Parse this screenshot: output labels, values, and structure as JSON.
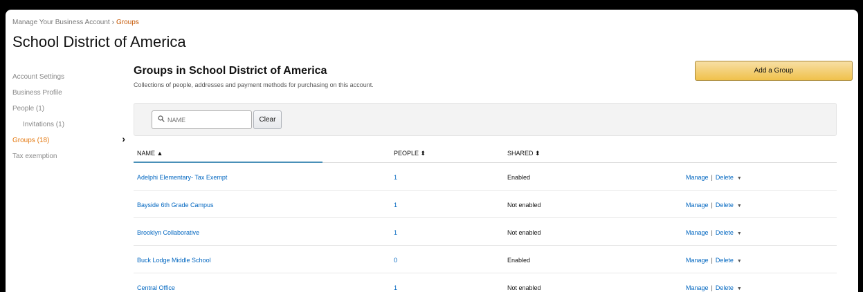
{
  "breadcrumb": {
    "parent": "Manage Your Business Account",
    "separator": "›",
    "current": "Groups"
  },
  "page_title": "School District of America",
  "sidebar": {
    "items": [
      {
        "label": "Account Settings"
      },
      {
        "label": "Business Profile"
      },
      {
        "label": "People (1)"
      },
      {
        "label": "Invitations (1)"
      },
      {
        "label": "Groups (18)"
      },
      {
        "label": "Tax exemption"
      }
    ],
    "active_chevron": "›"
  },
  "main": {
    "title": "Groups in School District of America",
    "subtitle": "Collections of people, addresses and payment methods for purchasing on this account.",
    "add_button": "Add a Group"
  },
  "search": {
    "placeholder": "NAME",
    "clear_label": "Clear"
  },
  "table": {
    "headers": {
      "name": "NAME ▲",
      "people": "PEOPLE ⬍",
      "shared": "SHARED ⬍"
    },
    "rows": [
      {
        "name": "Adelphi Elementary- Tax Exempt",
        "people": "1",
        "shared": "Enabled",
        "manage": "Manage",
        "sep": "|",
        "delete": "Delete"
      },
      {
        "name": "Bayside 6th Grade Campus",
        "people": "1",
        "shared": "Not enabled",
        "manage": "Manage",
        "sep": "|",
        "delete": "Delete"
      },
      {
        "name": "Brooklyn Collaborative",
        "people": "1",
        "shared": "Not enabled",
        "manage": "Manage",
        "sep": "|",
        "delete": "Delete"
      },
      {
        "name": "Buck Lodge Middle School",
        "people": "0",
        "shared": "Enabled",
        "manage": "Manage",
        "sep": "|",
        "delete": "Delete"
      },
      {
        "name": "Central Office",
        "people": "1",
        "shared": "Not enabled",
        "manage": "Manage",
        "sep": "|",
        "delete": "Delete"
      }
    ]
  },
  "colors": {
    "accent": "#e47911",
    "link": "#0066c0",
    "button_yellow": "#f0c14b"
  },
  "icons": {
    "search": "search-icon",
    "chevron": "chevron-right-icon",
    "caret": "caret-down-icon"
  }
}
